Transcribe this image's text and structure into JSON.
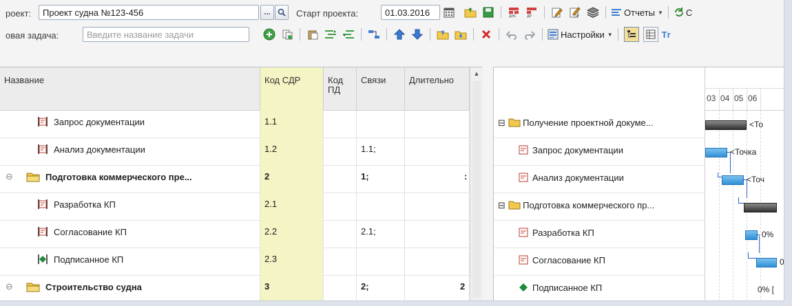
{
  "header": {
    "project_label": "роект:",
    "project_value": "Проект судна №123-456",
    "ellipsis": "...",
    "start_label": "Старт проекта:",
    "start_value": "01.03.2016",
    "reports_label": "Отчеты",
    "refresh_partial": "С"
  },
  "toolbar2": {
    "new_task_label": "овая задача:",
    "new_task_placeholder": "Введите название задачи",
    "settings_label": "Настройки",
    "partial_text": "Тr"
  },
  "table": {
    "columns": [
      "Название",
      "Код СДР",
      "Код ПД",
      "Связи",
      "Длительно"
    ],
    "rows": [
      {
        "name": "Запрос документации",
        "wbs": "1.1",
        "pd": "",
        "links": "",
        "dur": "",
        "type": "task"
      },
      {
        "name": "Анализ документации",
        "wbs": "1.2",
        "pd": "",
        "links": "1.1;",
        "dur": "",
        "type": "task"
      },
      {
        "name": "Подготовка коммерческого пре...",
        "wbs": "2",
        "pd": "",
        "links": "1;",
        "dur": "",
        "type": "summary"
      },
      {
        "name": "Разработка КП",
        "wbs": "2.1",
        "pd": "",
        "links": "",
        "dur": "",
        "type": "task"
      },
      {
        "name": "Согласование КП",
        "wbs": "2.2",
        "pd": "",
        "links": "2.1;",
        "dur": "",
        "type": "task"
      },
      {
        "name": "Подписанное КП",
        "wbs": "2.3",
        "pd": "",
        "links": "",
        "dur": "",
        "type": "milestone"
      },
      {
        "name": "Строительство судна",
        "wbs": "3",
        "pd": "",
        "links": "2;",
        "dur": "2",
        "type": "summary"
      }
    ]
  },
  "gantt": {
    "days": [
      "03",
      "04",
      "05",
      "06"
    ],
    "rows": [
      {
        "name": "Получение проектной докуме...",
        "type": "summary",
        "bar_label": "<То"
      },
      {
        "name": "Запрос документации",
        "type": "task",
        "bar_label": "<Точка"
      },
      {
        "name": "Анализ документации",
        "type": "task",
        "bar_label": "<Точ"
      },
      {
        "name": "Подготовка коммерческого пр...",
        "type": "summary",
        "bar_label": ""
      },
      {
        "name": "Разработка КП",
        "type": "task",
        "bar_label": "0%"
      },
      {
        "name": "Согласование КП",
        "type": "task",
        "bar_label": "0"
      },
      {
        "name": "Подписанное КП",
        "type": "milestone",
        "bar_label": "0% ["
      }
    ]
  },
  "colors": {
    "folder": "#f2c94c",
    "task_icon": "#c0392b",
    "milestone": "#1f8a3a",
    "bar_blue": "#2f8fd6",
    "link": "#2b63c9"
  }
}
